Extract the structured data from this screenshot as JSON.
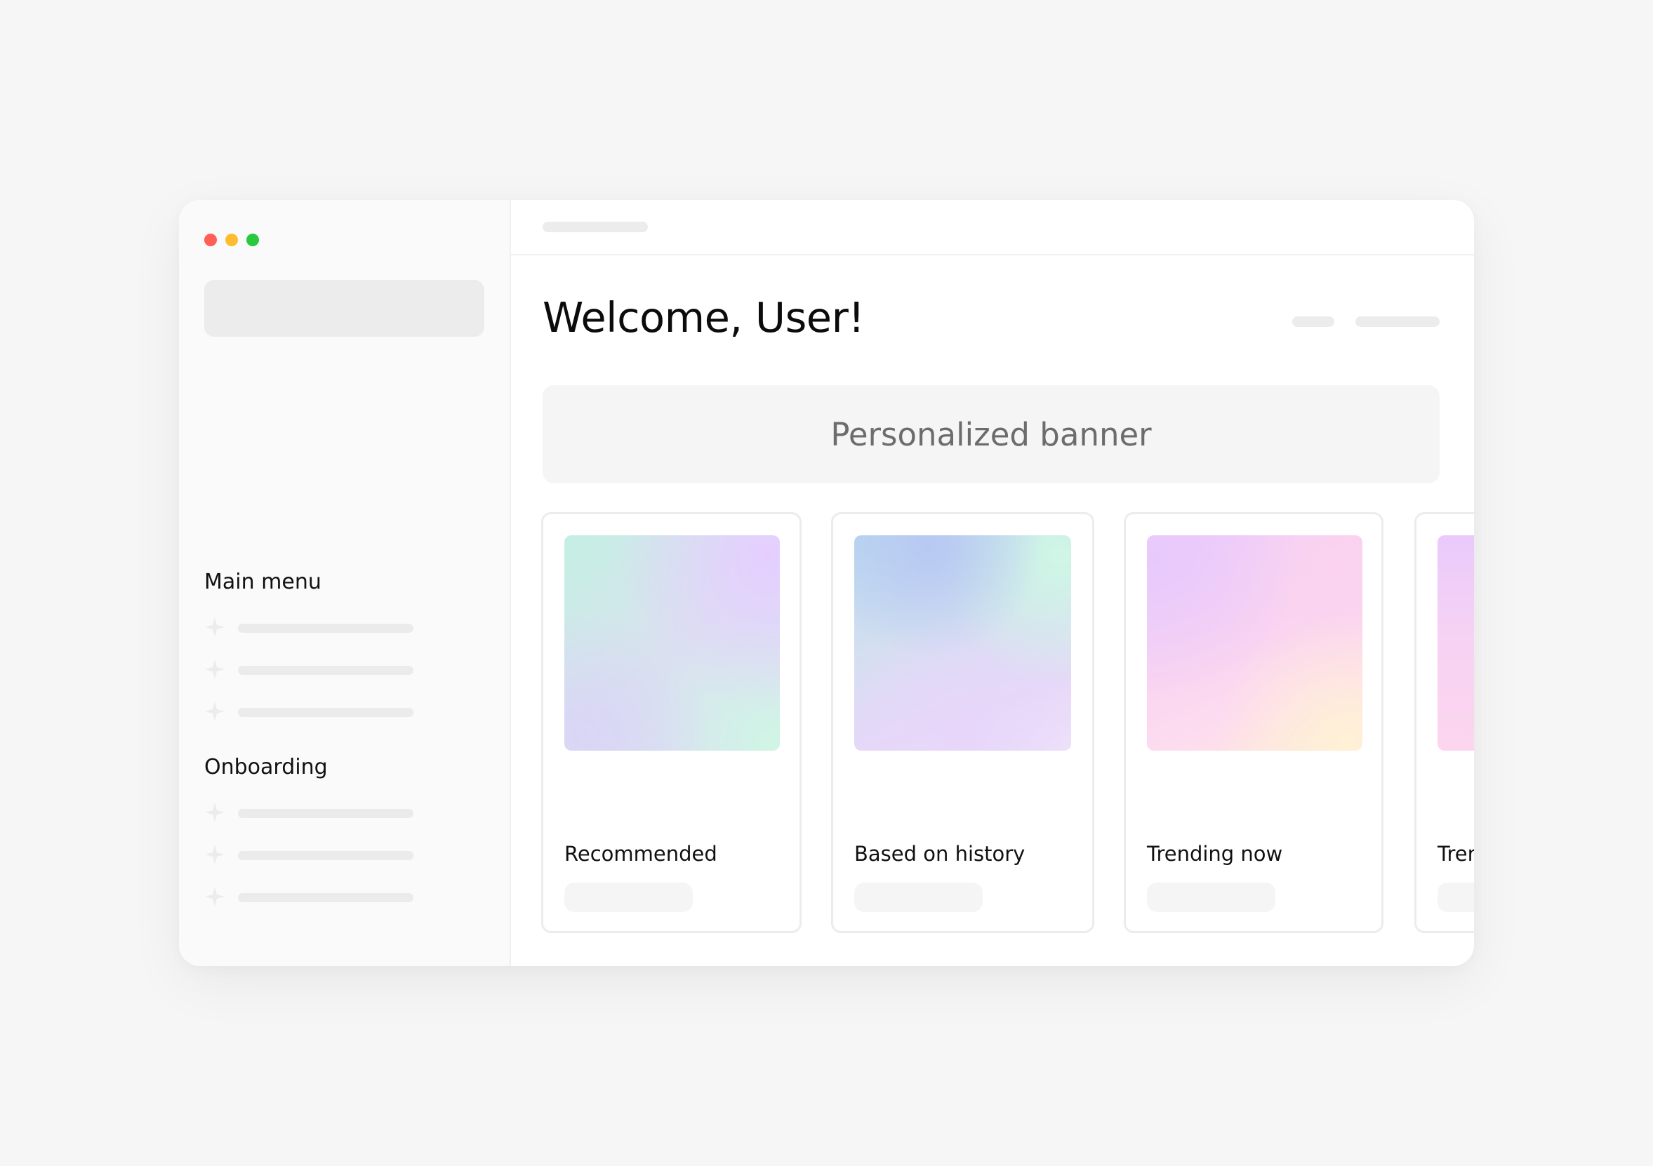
{
  "sidebar": {
    "sections": [
      {
        "title": "Main menu",
        "items": 3
      },
      {
        "title": "Onboarding",
        "items": 3
      }
    ]
  },
  "main": {
    "title": "Welcome, User!",
    "banner": "Personalized banner",
    "cards": [
      {
        "label": "Recommended"
      },
      {
        "label": "Based on history"
      },
      {
        "label": "Trending now"
      },
      {
        "label": "Trending now"
      }
    ]
  },
  "colors": {
    "close": "#ff5f57",
    "minimize": "#febc2e",
    "zoom": "#28c840"
  },
  "icons": {
    "nav": "sparkle-icon"
  }
}
